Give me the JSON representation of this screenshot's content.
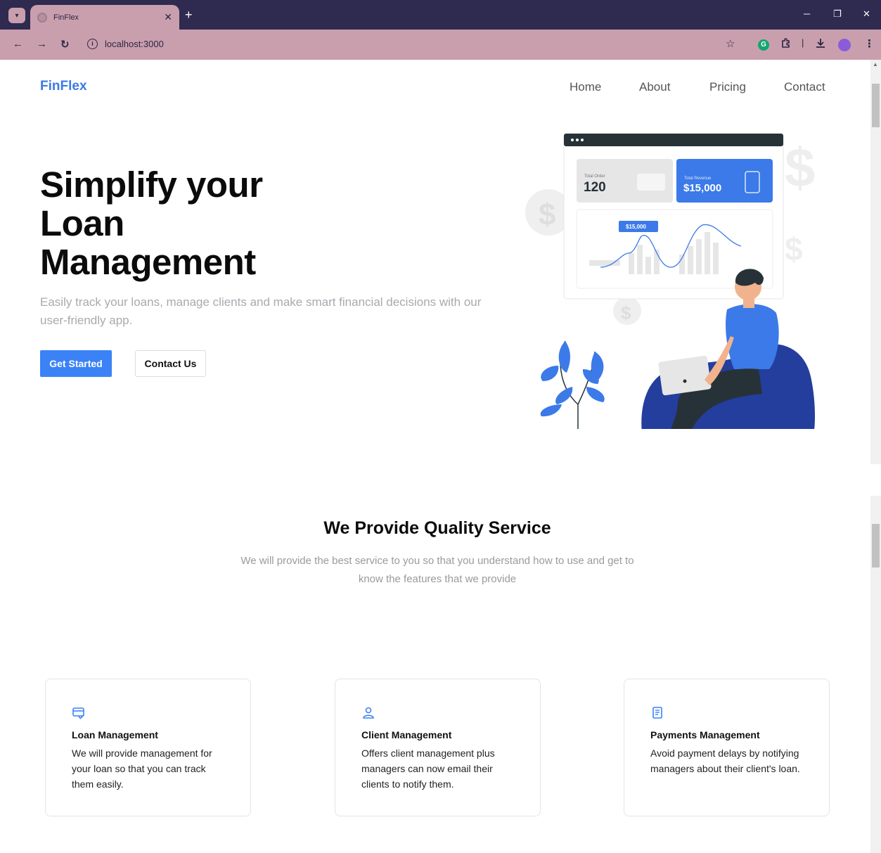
{
  "browser": {
    "tab_title": "FinFlex",
    "tab_close": "✕",
    "new_tab": "+",
    "url": "localhost:3000",
    "icons": {
      "menu": "chevron-down-icon",
      "back": "arrow-left-icon",
      "forward": "arrow-right-icon",
      "reload": "reload-icon",
      "info": "info-icon",
      "bookmark": "star-icon",
      "grammarly": "grammarly-icon",
      "extensions": "puzzle-icon",
      "download": "download-icon",
      "profile": "profile-avatar-icon",
      "more": "kebab-menu-icon"
    }
  },
  "nav": {
    "logo": "FinFlex",
    "links": [
      "Home",
      "About",
      "Pricing",
      "Contact"
    ]
  },
  "hero": {
    "title": "Simplify your Loan Management",
    "subtitle": "Easily track your loans, manage clients and make smart financial decisions with our user-friendly app.",
    "primary_cta": "Get Started",
    "secondary_cta": "Contact Us",
    "illustration": {
      "total_order_label": "Total Order",
      "total_order_value": "120",
      "total_revenue_label": "Total Revenue",
      "total_revenue_value": "$15,000",
      "chart_tooltip": "$15,000"
    }
  },
  "services": {
    "title": "We Provide Quality Service",
    "subtitle": "We will provide the best service to you so that you understand how to use and get to know the features that we provide",
    "cards": [
      {
        "icon": "credit-card-check-icon",
        "title": "Loan Management",
        "text": "We will provide management for your loan so that you can track them easily."
      },
      {
        "icon": "user-icon",
        "title": "Client Management",
        "text": "Offers client management plus managers can now email their clients to notify them."
      },
      {
        "icon": "receipt-icon",
        "title": "Payments Management",
        "text": "Avoid payment delays by notifying managers about their client's loan."
      }
    ]
  },
  "colors": {
    "brand_blue": "#3b82f6",
    "chrome_dark": "#2f2a4f",
    "chrome_pink": "#c99fae"
  }
}
